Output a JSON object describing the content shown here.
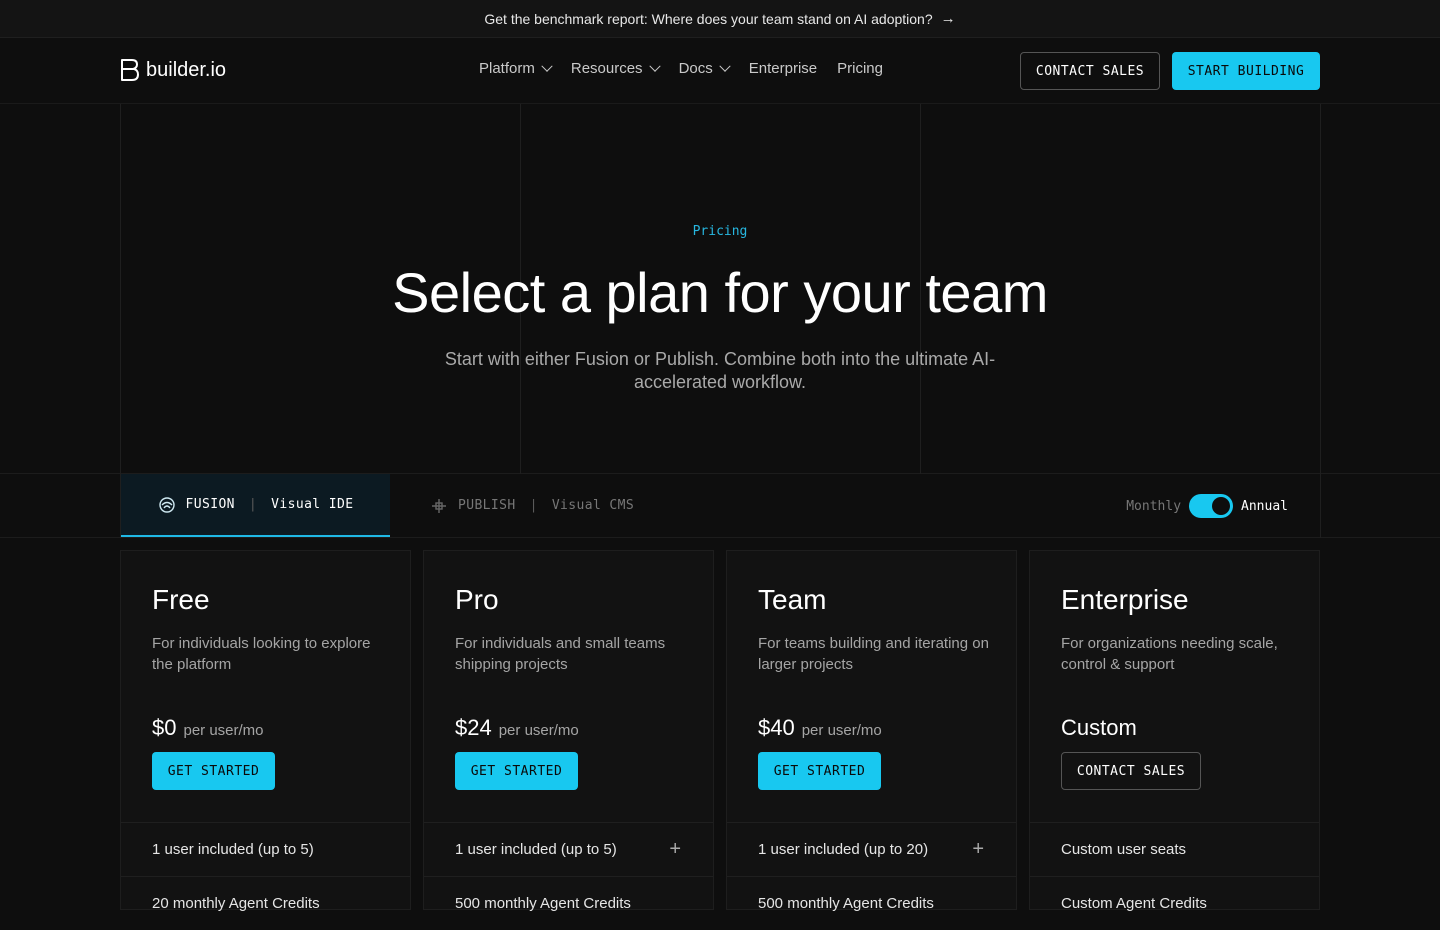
{
  "announcement": {
    "text": "Get the benchmark report: Where does your team stand on AI adoption?",
    "arrow": "→"
  },
  "header": {
    "logo_text": "builder.io",
    "nav": [
      {
        "label": "Platform",
        "dropdown": true
      },
      {
        "label": "Resources",
        "dropdown": true
      },
      {
        "label": "Docs",
        "dropdown": true
      },
      {
        "label": "Enterprise",
        "dropdown": false
      },
      {
        "label": "Pricing",
        "dropdown": false
      }
    ],
    "contact_sales": "CONTACT SALES",
    "start_building": "START BUILDING"
  },
  "hero": {
    "eyebrow": "Pricing",
    "title": "Select a plan for your team",
    "subtitle": "Start with either Fusion or Publish. Combine both into the ultimate AI-accelerated workflow."
  },
  "tabs": {
    "fusion": {
      "name": "FUSION",
      "sep": "|",
      "desc": "Visual IDE"
    },
    "publish": {
      "name": "PUBLISH",
      "sep": "|",
      "desc": "Visual CMS"
    }
  },
  "billing": {
    "monthly": "Monthly",
    "annual": "Annual",
    "annual_selected": true
  },
  "plans": [
    {
      "name": "Free",
      "desc": "For individuals looking to explore the platform",
      "amount": "$0",
      "per": "per user/mo",
      "cta": "GET STARTED",
      "cta_style": "cyan",
      "feature": "1 user included (up to 5)",
      "expandable": false,
      "feature2": "20 monthly Agent Credits"
    },
    {
      "name": "Pro",
      "desc": "For individuals and small teams shipping projects",
      "amount": "$24",
      "per": "per user/mo",
      "cta": "GET STARTED",
      "cta_style": "cyan",
      "feature": "1 user included (up to 5)",
      "expandable": true,
      "feature2": "500 monthly Agent Credits"
    },
    {
      "name": "Team",
      "desc": "For teams building and iterating on larger projects",
      "amount": "$40",
      "per": "per user/mo",
      "cta": "GET STARTED",
      "cta_style": "cyan",
      "feature": "1 user included (up to 20)",
      "expandable": true,
      "feature2": "500 monthly Agent Credits"
    },
    {
      "name": "Enterprise",
      "desc": "For organizations needing scale, control & support",
      "amount": "Custom",
      "per": "",
      "cta": "CONTACT SALES",
      "cta_style": "outline",
      "feature": "Custom user seats",
      "expandable": false,
      "feature2": "Custom Agent Credits"
    }
  ],
  "colors": {
    "accent": "#18c8f0",
    "background": "#0e0e0e",
    "card": "#121212"
  }
}
